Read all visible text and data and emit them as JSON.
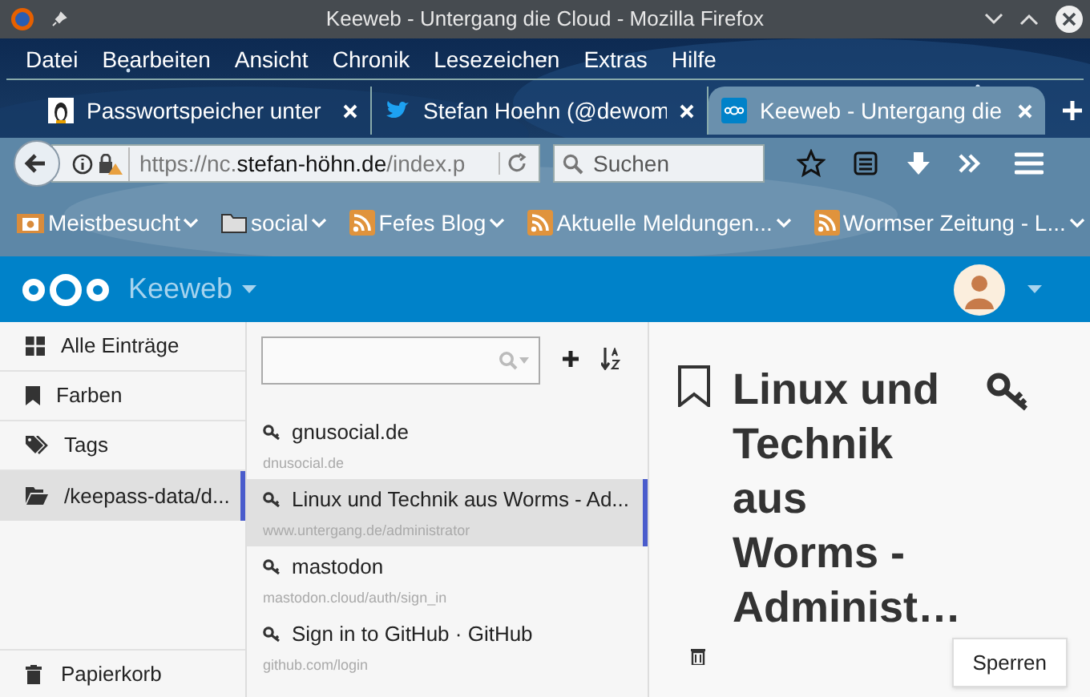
{
  "window": {
    "title": "Keeweb - Untergang die Cloud - Mozilla Firefox"
  },
  "menu": [
    "Datei",
    "Bearbeiten",
    "Ansicht",
    "Chronik",
    "Lesezeichen",
    "Extras",
    "Hilfe"
  ],
  "tabs": [
    {
      "label": "Passwortspeicher unter",
      "kind": "penguin",
      "selected": false
    },
    {
      "label": "Stefan Hoehn (@dewom",
      "kind": "bird",
      "selected": false
    },
    {
      "label": "Keeweb - Untergang die",
      "kind": "cloud",
      "selected": true
    }
  ],
  "address": {
    "prefix": "https://nc.",
    "host": "stefan-höhn.de",
    "path": "/index.p"
  },
  "search": {
    "placeholder": "Suchen"
  },
  "bookmarks": [
    {
      "label": "Meistbesucht",
      "kind": "smart"
    },
    {
      "label": "social",
      "kind": "folder"
    },
    {
      "label": "Fefes Blog",
      "kind": "feed"
    },
    {
      "label": "Aktuelle Meldungen...",
      "kind": "feed"
    },
    {
      "label": "Wormser Zeitung - L...",
      "kind": "feed"
    }
  ],
  "app": {
    "name": "Keeweb"
  },
  "sidebar": {
    "items": [
      {
        "label": "Alle Einträge",
        "kind": "all",
        "selected": false
      },
      {
        "label": "Farben",
        "kind": "colors",
        "selected": false
      },
      {
        "label": "Tags",
        "kind": "tags",
        "selected": false
      },
      {
        "label": "/keepass-data/d...",
        "kind": "folder",
        "selected": true
      }
    ],
    "trash": "Papierkorb"
  },
  "entries": [
    {
      "title": "gnusocial.de",
      "url": "dnusocial.de",
      "selected": false
    },
    {
      "title": "Linux und Technik aus Worms - Ad...",
      "url": "www.untergang.de/administrator",
      "selected": true
    },
    {
      "title": "mastodon",
      "url": "mastodon.cloud/auth/sign_in",
      "selected": false
    },
    {
      "title": "Sign in to GitHub · GitHub",
      "url": "github.com/login",
      "selected": false
    }
  ],
  "detail": {
    "title": "Linux und Technik aus Worms - Administ…",
    "lock_button": "Sperren"
  }
}
